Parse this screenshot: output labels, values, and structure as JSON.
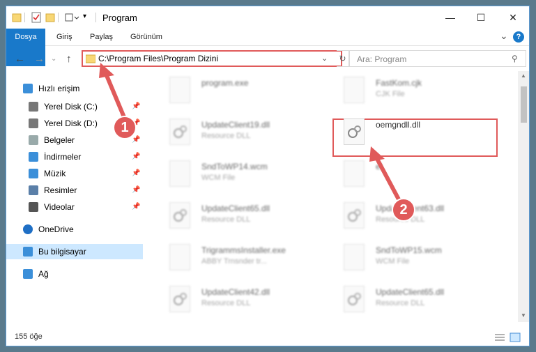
{
  "window": {
    "title": "Program",
    "controls": {
      "minimize": "—",
      "maximize": "☐",
      "close": "✕"
    }
  },
  "ribbon": {
    "tabs": [
      "Dosya",
      "Giriş",
      "Paylaş",
      "Görünüm"
    ],
    "expand": "⌄",
    "help": "?"
  },
  "address": {
    "path": "C:\\Program Files\\Program Dizini",
    "search_placeholder": "Ara: Program"
  },
  "sidebar": {
    "items": [
      {
        "label": "Hızlı erişim",
        "icon": "star-icon",
        "level": "top",
        "pinned": false
      },
      {
        "label": "Yerel Disk (C:)",
        "icon": "drive-icon",
        "level": "child",
        "pinned": true
      },
      {
        "label": "Yerel Disk (D:)",
        "icon": "drive-icon",
        "level": "child",
        "pinned": true
      },
      {
        "label": "Belgeler",
        "icon": "documents-icon",
        "level": "child",
        "pinned": true
      },
      {
        "label": "İndirmeler",
        "icon": "download-icon",
        "level": "child",
        "pinned": true
      },
      {
        "label": "Müzik",
        "icon": "music-icon",
        "level": "child",
        "pinned": true
      },
      {
        "label": "Resimler",
        "icon": "pictures-icon",
        "level": "child",
        "pinned": true
      },
      {
        "label": "Videolar",
        "icon": "videos-icon",
        "level": "child",
        "pinned": true
      },
      {
        "label": "OneDrive",
        "icon": "cloud-icon",
        "level": "top",
        "pinned": false
      },
      {
        "label": "Bu bilgisayar",
        "icon": "computer-icon",
        "level": "top",
        "pinned": false,
        "selected": true
      },
      {
        "label": "Ağ",
        "icon": "network-icon",
        "level": "top",
        "pinned": false
      }
    ]
  },
  "files": [
    {
      "name": "program.exe",
      "type": "",
      "blurred": true
    },
    {
      "name": "FastKom.cjk",
      "type": "CJK File",
      "blurred": true
    },
    {
      "name": "UpdateClient19.dll",
      "type": "Resource DLL",
      "blurred": true
    },
    {
      "name": "oemgndll.dll",
      "type": "",
      "blurred": false
    },
    {
      "name": "SndToWP14.wcm",
      "type": "WCM File",
      "blurred": true
    },
    {
      "name": "el",
      "type": "",
      "blurred": true
    },
    {
      "name": "UpdateClient65.dll",
      "type": "Resource DLL",
      "blurred": true
    },
    {
      "name": "UpdateClient63.dll",
      "type": "Resource DLL",
      "blurred": true
    },
    {
      "name": "TrigrammsInstaller.exe",
      "type": "ABBY Trnsnder tr...",
      "blurred": true
    },
    {
      "name": "SndToWP15.wcm",
      "type": "WCM File",
      "blurred": true
    },
    {
      "name": "UpdateClient42.dll",
      "type": "Resource DLL",
      "blurred": true
    },
    {
      "name": "UpdateClient65.dll",
      "type": "Resource DLL",
      "blurred": true
    }
  ],
  "status": {
    "count": "155 öğe"
  },
  "annotations": {
    "step1": "1",
    "step2": "2"
  },
  "colors": {
    "accent": "#1979ca",
    "annotation": "#e05a5a",
    "selected": "#cde8ff"
  }
}
